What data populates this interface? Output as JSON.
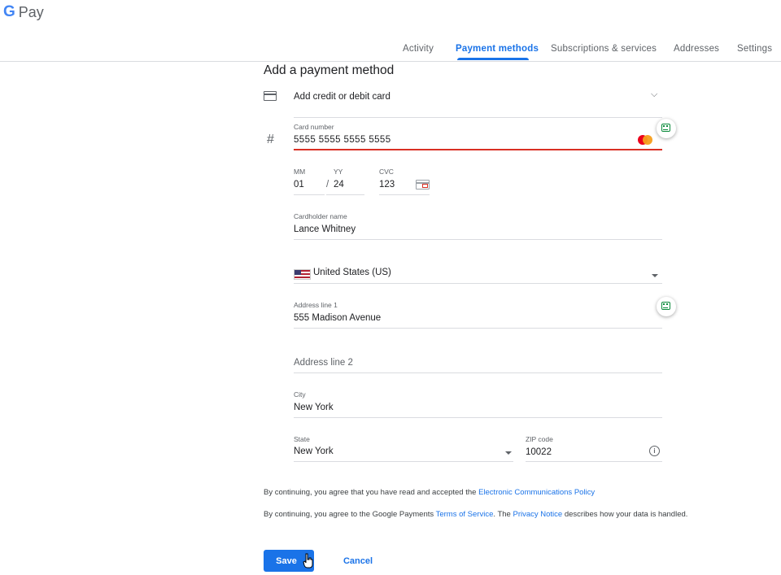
{
  "app": {
    "logo_g": "G",
    "logo_text": "Pay"
  },
  "nav": {
    "tabs": [
      {
        "label": "Activity",
        "active": false
      },
      {
        "label": "Payment methods",
        "active": true
      },
      {
        "label": "Subscriptions & services",
        "active": false
      },
      {
        "label": "Addresses",
        "active": false
      },
      {
        "label": "Settings",
        "active": false
      }
    ]
  },
  "form": {
    "title": "Add a payment method",
    "method_selector": {
      "label": "Add credit or debit card",
      "icon": "credit-card-icon"
    },
    "card_number": {
      "label": "Card number",
      "value": "5555  5555  5555  5555",
      "icon": "hash-icon",
      "brand": "mastercard"
    },
    "expiry": {
      "mm_label": "MM",
      "mm_value": "01",
      "yy_label": "YY",
      "yy_value": "24",
      "separator": "/"
    },
    "cvc": {
      "label": "CVC",
      "value": "123"
    },
    "cardholder": {
      "label": "Cardholder name",
      "value": "Lance Whitney"
    },
    "country": {
      "value": "United States (US)"
    },
    "address1": {
      "label": "Address line 1",
      "value": "555 Madison Avenue"
    },
    "address2": {
      "placeholder": "Address line 2"
    },
    "city": {
      "label": "City",
      "value": "New York"
    },
    "state": {
      "label": "State",
      "value": "New York"
    },
    "zip": {
      "label": "ZIP code",
      "value": "10022"
    }
  },
  "legal": {
    "line1_prefix": "By continuing, you agree that you have read and accepted the ",
    "line1_link": "Electronic Communications Policy",
    "line2_prefix": "By continuing, you agree to the Google Payments ",
    "line2_link1": "Terms of Service",
    "line2_mid": ". The ",
    "line2_link2": "Privacy Notice",
    "line2_suffix": " describes how your data is handled."
  },
  "actions": {
    "save_label": "Save",
    "cancel_label": "Cancel"
  },
  "colors": {
    "accent": "#1a73e8",
    "error": "#d93025",
    "extension_green": "#0a8a3a"
  }
}
